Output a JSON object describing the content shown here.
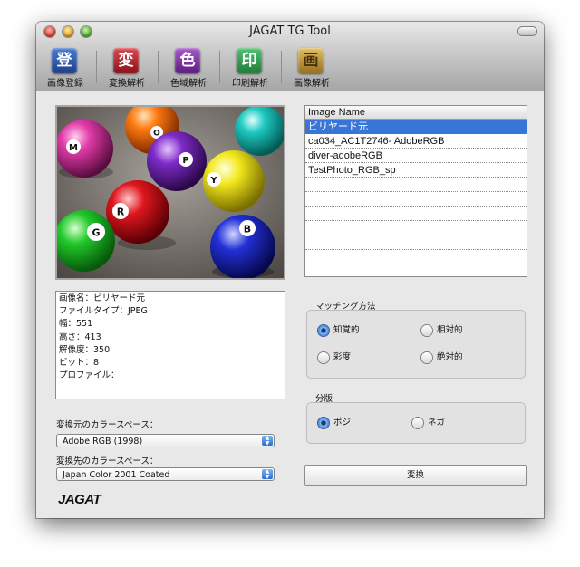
{
  "window": {
    "title": "JAGAT TG Tool"
  },
  "toolbar": {
    "items": [
      {
        "label": "画像登録",
        "glyph": "登",
        "color": "#2b57a8",
        "icon": "register-icon"
      },
      {
        "label": "変換解析",
        "glyph": "変",
        "color": "#b3202a",
        "icon": "convert-icon"
      },
      {
        "label": "色域解析",
        "glyph": "色",
        "color": "#7a2e9c",
        "icon": "gamut-icon"
      },
      {
        "label": "印刷解析",
        "glyph": "印",
        "color": "#2e9a4f",
        "icon": "print-icon"
      },
      {
        "label": "画像解析",
        "glyph": "画",
        "color": "#b88a2e",
        "icon": "image-analysis-icon"
      }
    ]
  },
  "image_info": {
    "name": "画像名：ビリヤード元",
    "filetype": "ファイルタイプ：JPEG",
    "width": "幅：551",
    "height": "高さ：413",
    "resolution": "解像度：350",
    "bits": "ビット：8",
    "profile": "プロファイル："
  },
  "source_colorspace": {
    "label": "変換元のカラースペース：",
    "value": "Adobe RGB (1998)"
  },
  "dest_colorspace": {
    "label": "変換先のカラースペース：",
    "value": "Japan Color 2001 Coated"
  },
  "logo": {
    "text": "JAGAT"
  },
  "image_list": {
    "header": "Image Name",
    "rows": [
      "ビリヤード元",
      "ca034_AC1T2746- AdobeRGB",
      "diver-adobeRGB",
      "TestPhoto_RGB_sp",
      "",
      "",
      "",
      "",
      "",
      ""
    ],
    "selected_index": 0
  },
  "matching": {
    "title": "マッチング方法",
    "options": [
      {
        "label": "知覚的",
        "selected": true
      },
      {
        "label": "相対的",
        "selected": false
      },
      {
        "label": "彩度",
        "selected": false
      },
      {
        "label": "絶対的",
        "selected": false
      }
    ]
  },
  "separation": {
    "title": "分版",
    "options": [
      {
        "label": "ポジ",
        "selected": true
      },
      {
        "label": "ネガ",
        "selected": false
      }
    ]
  },
  "convert_button": {
    "label": "変換"
  },
  "balls": [
    {
      "label": "M",
      "color": "#e23ca9"
    },
    {
      "label": "O",
      "color": "#ff7a12"
    },
    {
      "label": "P",
      "color": "#7d2bc9"
    },
    {
      "label": "Y",
      "color": "#f3e91d"
    },
    {
      "label": "R",
      "color": "#e0161e"
    },
    {
      "label": "G",
      "color": "#22c92b"
    },
    {
      "label": "B",
      "color": "#2230d6"
    }
  ]
}
